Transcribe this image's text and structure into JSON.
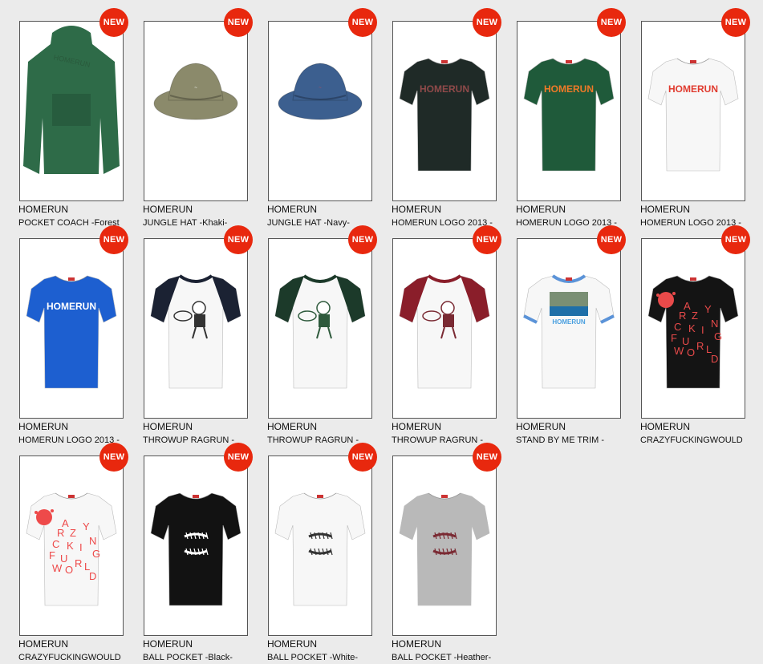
{
  "badge_label": "NEW",
  "products": [
    {
      "brand": "HOMERUN",
      "name": "POCKET COACH -Forest",
      "type": "jacket",
      "color": "#2e6b48",
      "print": "HOMERUN",
      "print_color": "#2a5a3c",
      "print_stroke": "none"
    },
    {
      "brand": "HOMERUN",
      "name": "JUNGLE HAT -Khaki-",
      "type": "hat",
      "color": "#8b8a6b",
      "print": "",
      "print_color": "#ffffff",
      "print_stroke": "none"
    },
    {
      "brand": "HOMERUN",
      "name": "JUNGLE HAT -Navy-",
      "type": "hat",
      "color": "#3c5f8f",
      "print": "",
      "print_color": "#b84d5a",
      "print_stroke": "none"
    },
    {
      "brand": "HOMERUN",
      "name": "HOMERUN LOGO 2013 -",
      "type": "tee",
      "color": "#1f2a27",
      "print": "HOMERUN",
      "print_color": "#8f4a4a",
      "print_stroke": "none"
    },
    {
      "brand": "HOMERUN",
      "name": "HOMERUN LOGO 2013 -",
      "type": "tee",
      "color": "#1f5a3a",
      "print": "HOMERUN",
      "print_color": "#f07a28",
      "print_stroke": "none"
    },
    {
      "brand": "HOMERUN",
      "name": "HOMERUN LOGO 2013 -",
      "type": "tee",
      "color": "#f7f7f7",
      "print": "HOMERUN",
      "print_color": "#e03b2f",
      "print_stroke": "none"
    },
    {
      "brand": "HOMERUN",
      "name": "HOMERUN LOGO 2013 -",
      "type": "tee",
      "color": "#1d5fd0",
      "print": "HOMERUN",
      "print_color": "#ffffff",
      "print_stroke": "none"
    },
    {
      "brand": "HOMERUN",
      "name": "THROWUP RAGRUN -",
      "type": "raglan",
      "color": "#f7f7f7",
      "sleeve": "#1b2233",
      "print_color": "#333333"
    },
    {
      "brand": "HOMERUN",
      "name": "THROWUP RAGRUN -",
      "type": "raglan",
      "color": "#f7f7f7",
      "sleeve": "#1c3a2a",
      "print_color": "#2e5a3c"
    },
    {
      "brand": "HOMERUN",
      "name": "THROWUP RAGRUN -",
      "type": "raglan",
      "color": "#f7f7f7",
      "sleeve": "#8a1e2a",
      "print_color": "#7a2a33"
    },
    {
      "brand": "HOMERUN",
      "name": "STAND BY ME TRIM -",
      "type": "ringer",
      "color": "#f7f7f7",
      "trim": "#5b93d8",
      "print": "HOMERUN",
      "print_color": "#4aa0e0"
    },
    {
      "brand": "HOMERUN",
      "name": "CRAZYFUCKINGWOULD",
      "type": "crazy",
      "color": "#141414",
      "print_color": "#e84a4a"
    },
    {
      "brand": "HOMERUN",
      "name": "CRAZYFUCKINGWOULD",
      "type": "crazy",
      "color": "#f7f7f7",
      "print_color": "#ee4a4a"
    },
    {
      "brand": "HOMERUN",
      "name": "BALL POCKET -Black-",
      "type": "ball",
      "color": "#121212",
      "print_color": "#ffffff"
    },
    {
      "brand": "HOMERUN",
      "name": "BALL POCKET -White-",
      "type": "ball",
      "color": "#f7f7f7",
      "print_color": "#333333"
    },
    {
      "brand": "HOMERUN",
      "name": "BALL POCKET -Heather-",
      "type": "ball",
      "color": "#b9b9b9",
      "print_color": "#7a2a33"
    }
  ]
}
